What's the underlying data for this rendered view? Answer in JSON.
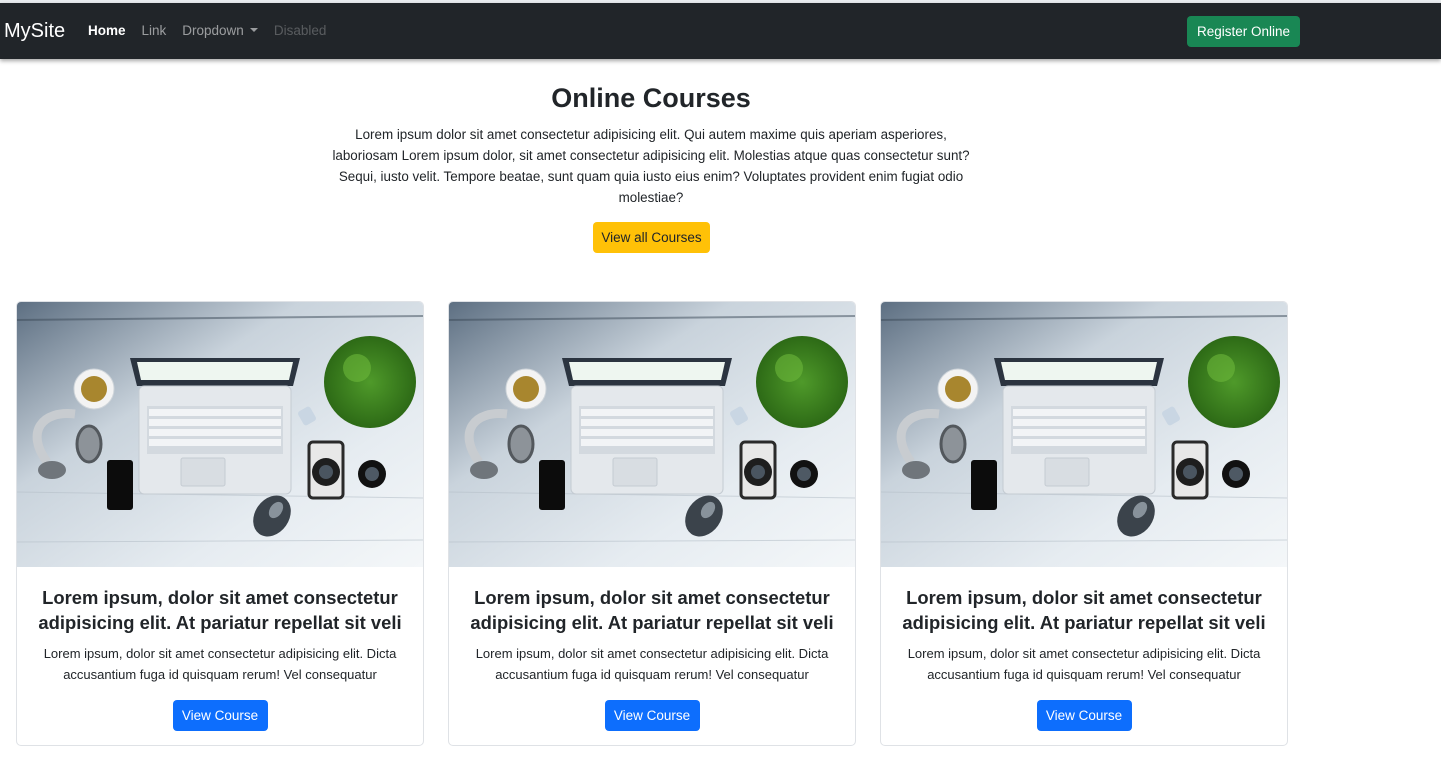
{
  "nav": {
    "brand": "MySite",
    "links": [
      {
        "label": "Home",
        "state": "active"
      },
      {
        "label": "Link",
        "state": "normal"
      },
      {
        "label": "Dropdown",
        "state": "dropdown"
      },
      {
        "label": "Disabled",
        "state": "disabled"
      }
    ],
    "register_label": "Register Online"
  },
  "hero": {
    "title": "Online Courses",
    "text": "Lorem ipsum dolor sit amet consectetur adipisicing elit. Qui autem maxime quis aperiam asperiores, laboriosam Lorem ipsum dolor, sit amet consectetur adipisicing elit. Molestias atque quas consectetur sunt? Sequi, iusto velit. Tempore beatae, sunt quam quia iusto eius enim? Voluptates provident enim fugiat odio molestiae?",
    "button_label": "View all Courses"
  },
  "cards": [
    {
      "title": "Lorem ipsum, dolor sit amet consectetur adipisicing elit. At pariatur repellat sit veli",
      "text": "Lorem ipsum, dolor sit amet consectetur adipisicing elit. Dicta accusantium fuga id quisquam rerum! Vel consequatur",
      "button_label": "View Course",
      "image": "desk-laptop-photo"
    },
    {
      "title": "Lorem ipsum, dolor sit amet consectetur adipisicing elit. At pariatur repellat sit veli",
      "text": "Lorem ipsum, dolor sit amet consectetur adipisicing elit. Dicta accusantium fuga id quisquam rerum! Vel consequatur",
      "button_label": "View Course",
      "image": "desk-laptop-photo"
    },
    {
      "title": "Lorem ipsum, dolor sit amet consectetur adipisicing elit. At pariatur repellat sit veli",
      "text": "Lorem ipsum, dolor sit amet consectetur adipisicing elit. Dicta accusantium fuga id quisquam rerum! Vel consequatur",
      "button_label": "View Course",
      "image": "desk-laptop-photo"
    }
  ],
  "colors": {
    "navbar": "#212529",
    "register": "#198754",
    "view_all": "#ffc107",
    "view_course": "#0d6efd"
  }
}
